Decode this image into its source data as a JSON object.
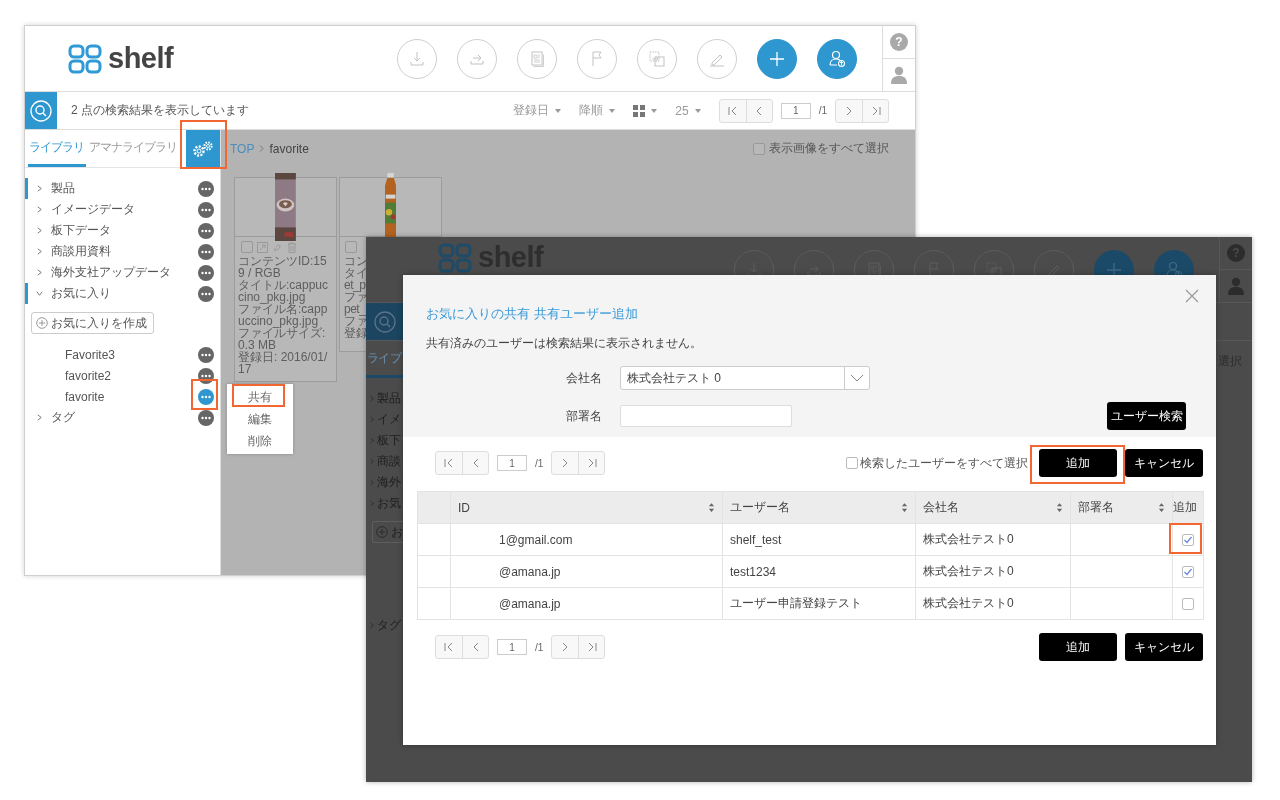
{
  "back_window": {
    "logo": "shelf",
    "help_label": "?",
    "toolbar": {
      "result_text": "2 点の検索結果を表示しています",
      "sort_options": [
        "登録日",
        "降順"
      ],
      "per_page": "25",
      "pager": {
        "page": "1",
        "total": "/1"
      }
    },
    "sidebar": {
      "tabs": [
        {
          "label": "ライブラリ",
          "selected": true
        },
        {
          "label": "アマナライブラリ",
          "selected": false
        }
      ],
      "items": [
        {
          "label": "製品",
          "expanded": false,
          "marked": true
        },
        {
          "label": "イメージデータ",
          "expanded": false,
          "marked": false
        },
        {
          "label": "板下データ",
          "expanded": false,
          "marked": false
        },
        {
          "label": "商談用資料",
          "expanded": false,
          "marked": false
        },
        {
          "label": "海外支社アップデータ",
          "expanded": false,
          "marked": false
        },
        {
          "label": "お気に入り",
          "expanded": true,
          "marked": true,
          "create_button": "お気に入りを作成",
          "children": [
            {
              "label": "Favorite3",
              "active": false
            },
            {
              "label": "favorite2",
              "active": false
            },
            {
              "label": "favorite",
              "active": true
            }
          ]
        },
        {
          "label": "タグ",
          "expanded": false,
          "marked": false
        }
      ]
    },
    "context_menu": [
      {
        "label": "共有"
      },
      {
        "label": "編集"
      },
      {
        "label": "削除"
      }
    ],
    "breadcrumb": [
      "TOP",
      "favorite"
    ],
    "select_all": {
      "label": "表示画像をすべて選択",
      "checked": false
    },
    "cards": [
      {
        "kind": "carton",
        "checked": false,
        "tools": true,
        "lines": [
          "コンテンツID:159 / RGB",
          "タイトル:cappuccino_pkg.jpg",
          "ファイル名:cappuccino_pkg.jpg",
          "ファイルサイズ:0.3 MB",
          "登録日: 2016/01/17"
        ]
      },
      {
        "kind": "bottle",
        "checked": false,
        "tools": false,
        "lines": [
          "コン",
          "タイ",
          "et_p",
          "ファ",
          "pet_",
          "ファ",
          "登録"
        ]
      }
    ]
  },
  "front_window": {
    "logo": "shelf",
    "help_label": "?",
    "sidebar_fragments": [
      {
        "kind": "tab",
        "label": "ライブ"
      },
      {
        "kind": "item",
        "label": "製品"
      },
      {
        "kind": "item",
        "label": "イメ"
      },
      {
        "kind": "item",
        "label": "板下"
      },
      {
        "kind": "item",
        "label": "商談"
      },
      {
        "kind": "item",
        "label": "海外"
      },
      {
        "kind": "item",
        "label": "お気"
      },
      {
        "kind": "button",
        "label": "お"
      },
      {
        "kind": "tail_item",
        "label": "タグ"
      }
    ],
    "edge_text": "選択",
    "dialog": {
      "title": "お気に入りの共有 共有ユーザー追加",
      "note": "共有済みのユーザーは検索結果に表示されません。",
      "fields": [
        {
          "kind": "select",
          "label": "会社名",
          "value": "株式会社テスト 0"
        },
        {
          "kind": "text",
          "label": "部署名"
        }
      ],
      "search_button": "ユーザー検索",
      "pager": {
        "page": "1",
        "total": "/1"
      },
      "select_all": {
        "label": "検索したユーザーをすべて選択",
        "checked": false
      },
      "buttons": [
        "追加",
        "キャンセル"
      ],
      "table": {
        "columns": [
          {
            "label": "ID",
            "sortable": true
          },
          {
            "label": "ユーザー名",
            "sortable": true
          },
          {
            "label": "会社名",
            "sortable": true
          },
          {
            "label": "部署名",
            "sortable": true
          },
          {
            "label": "追加",
            "sortable": false
          }
        ],
        "rows": [
          {
            "id": "1@gmail.com",
            "user_name": "shelf_test",
            "company": "株式会社テスト0",
            "add": true
          },
          {
            "id": "@amana.jp",
            "user_name": "test1234",
            "company": "株式会社テスト0",
            "add": true
          },
          {
            "id": "@amana.jp",
            "user_name": "ユーザー申請登録テスト",
            "company": "株式会社テスト0",
            "add": false
          }
        ]
      },
      "bottom_pager": {
        "page": "1",
        "total": "/1"
      },
      "bottom_buttons": [
        "追加",
        "キャンセル"
      ]
    }
  }
}
